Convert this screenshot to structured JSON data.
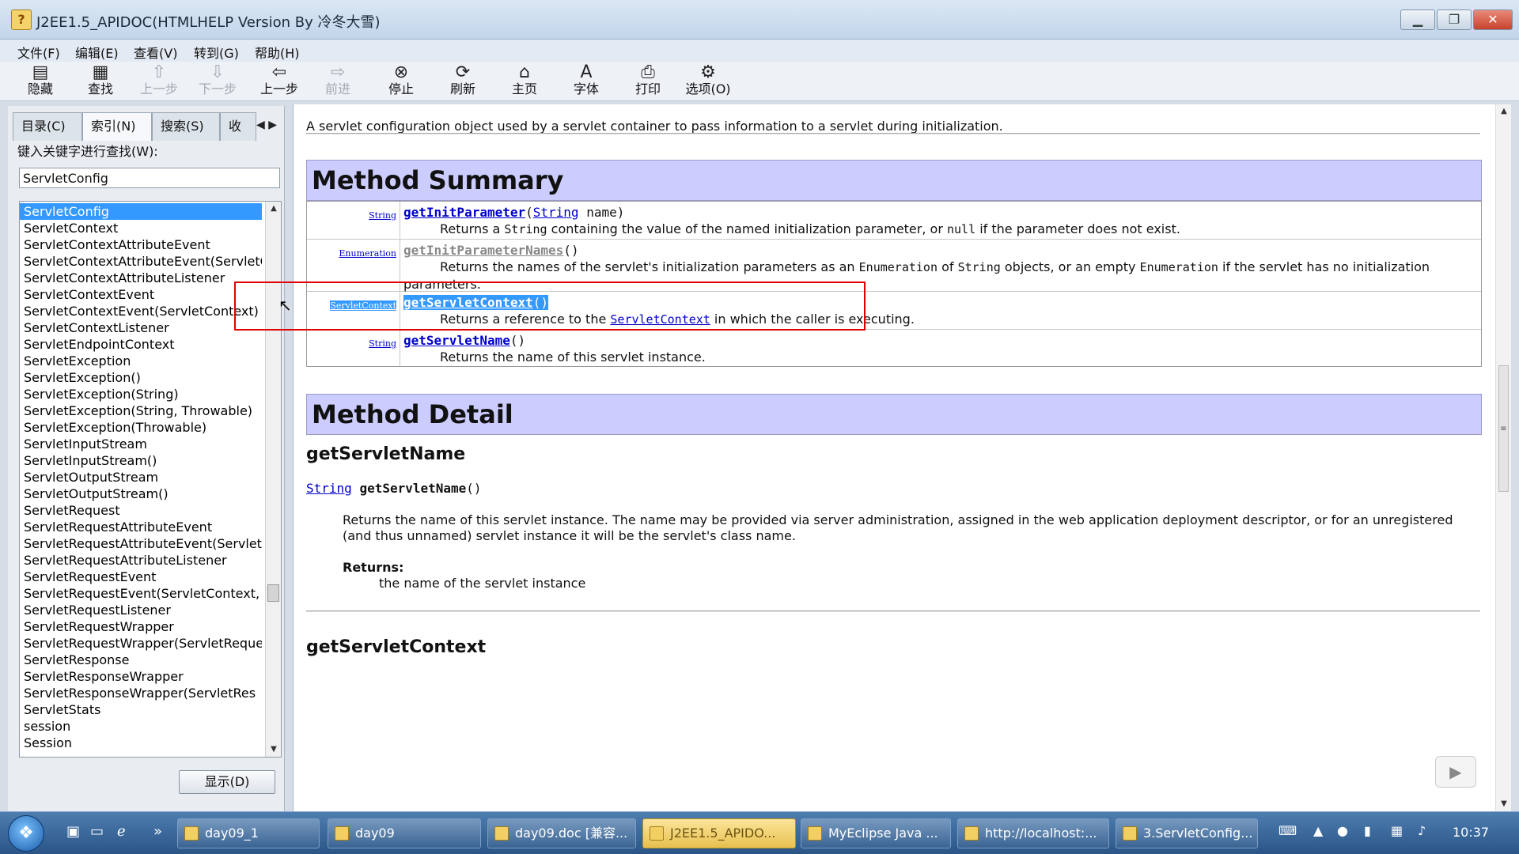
{
  "window": {
    "title": "J2EE1.5_APIDOC(HTMLHELP Version By 冷冬大雪)",
    "app_icon": "?"
  },
  "menu": [
    "文件(F)",
    "编辑(E)",
    "查看(V)",
    "转到(G)",
    "帮助(H)"
  ],
  "toolbar": [
    {
      "label": "隐藏",
      "icon": "hide-icon",
      "glyph": "▤",
      "enabled": true
    },
    {
      "label": "查找",
      "icon": "find-icon",
      "glyph": "▦",
      "enabled": true
    },
    {
      "label": "上一步",
      "icon": "up-arrow-icon",
      "glyph": "⇧",
      "enabled": false
    },
    {
      "label": "下一步",
      "icon": "down-arrow-icon",
      "glyph": "⇩",
      "enabled": false
    },
    {
      "label": "上一步",
      "icon": "back-arrow-icon",
      "glyph": "⇦",
      "enabled": true
    },
    {
      "label": "前进",
      "icon": "forward-arrow-icon",
      "glyph": "⇨",
      "enabled": false
    },
    {
      "label": "停止",
      "icon": "stop-icon",
      "glyph": "⊗",
      "enabled": true
    },
    {
      "label": "刷新",
      "icon": "refresh-icon",
      "glyph": "⟳",
      "enabled": true
    },
    {
      "label": "主页",
      "icon": "home-icon",
      "glyph": "⌂",
      "enabled": true
    },
    {
      "label": "字体",
      "icon": "font-icon",
      "glyph": "A",
      "enabled": true
    },
    {
      "label": "打印",
      "icon": "print-icon",
      "glyph": "⎙",
      "enabled": true
    },
    {
      "label": "选项(O)",
      "icon": "options-icon",
      "glyph": "⚙",
      "enabled": true
    }
  ],
  "left_pane": {
    "tabs": [
      "目录(C)",
      "索引(N)",
      "搜索(S)",
      "收"
    ],
    "active_tab": 1,
    "keyword_label": "键入关键字进行查找(W):",
    "keyword_value": "ServletConfig",
    "index_items": [
      "ServletConfig",
      "ServletContext",
      "ServletContextAttributeEvent",
      "ServletContextAttributeEvent(ServletCo",
      "ServletContextAttributeListener",
      "ServletContextEvent",
      "ServletContextEvent(ServletContext)",
      "ServletContextListener",
      "ServletEndpointContext",
      "ServletException",
      "ServletException()",
      "ServletException(String)",
      "ServletException(String, Throwable)",
      "ServletException(Throwable)",
      "ServletInputStream",
      "ServletInputStream()",
      "ServletOutputStream",
      "ServletOutputStream()",
      "ServletRequest",
      "ServletRequestAttributeEvent",
      "ServletRequestAttributeEvent(ServletC",
      "ServletRequestAttributeListener",
      "ServletRequestEvent",
      "ServletRequestEvent(ServletContext, S",
      "ServletRequestListener",
      "ServletRequestWrapper",
      "ServletRequestWrapper(ServletReque",
      "ServletResponse",
      "ServletResponseWrapper",
      "ServletResponseWrapper(ServletRes",
      "ServletStats",
      "session",
      "Session"
    ],
    "selected_index": 0,
    "display_button": "显示(D)"
  },
  "content": {
    "intro": "A servlet configuration object used by a servlet container to pass information to a servlet during initialization.",
    "method_summary_heading": "Method Summary",
    "methods": [
      {
        "type": "String",
        "name": "getInitParameter",
        "param_type": "String",
        "param_name": " name",
        "desc_parts": [
          "Returns a ",
          "String",
          " containing the value of the named initialization parameter, or ",
          "null",
          " if the parameter does not exist."
        ]
      },
      {
        "type": "Enumeration",
        "name": "getInitParameterNames",
        "desc_parts": [
          "Returns the names of the servlet's initialization parameters as an ",
          "Enumeration",
          " of ",
          "String",
          " objects, or an empty ",
          "Enumeration",
          " if the servlet has no initialization"
        ],
        "desc_cont": "parameters."
      },
      {
        "type": "ServletContext",
        "name": "getServletContext",
        "desc_parts": [
          "Returns a reference to the ",
          "ServletContext",
          " in which the caller is executing."
        ]
      },
      {
        "type": "String",
        "name": "getServletName",
        "desc": "Returns the name of this servlet instance."
      }
    ],
    "method_detail_heading": "Method Detail",
    "detail": {
      "heading": "getServletName",
      "sig_type": "String",
      "sig_name": "getServletName",
      "sig_parens": "()",
      "description": "Returns the name of this servlet instance. The name may be provided via server administration, assigned in the web application deployment descriptor, or for an unregistered (and thus unnamed) servlet instance it will be the servlet's class name.",
      "returns_label": "Returns:",
      "returns_value": "the name of the servlet instance"
    },
    "next_heading": "getServletContext"
  },
  "taskbar": {
    "tasks": [
      {
        "label": "day09_1",
        "active": false
      },
      {
        "label": "day09",
        "active": false
      },
      {
        "label": "day09.doc [兼容...",
        "active": false
      },
      {
        "label": "J2EE1.5_APIDO...",
        "active": true
      },
      {
        "label": "MyEclipse Java ...",
        "active": false
      },
      {
        "label": "http://localhost:...",
        "active": false
      },
      {
        "label": "3.ServletConfig...",
        "active": false
      }
    ],
    "clock": "10:37"
  },
  "colors": {
    "section_header": "#ccccff",
    "link": "#0000cc",
    "selection": "#3399ff",
    "highlight_box": "#e00000"
  }
}
